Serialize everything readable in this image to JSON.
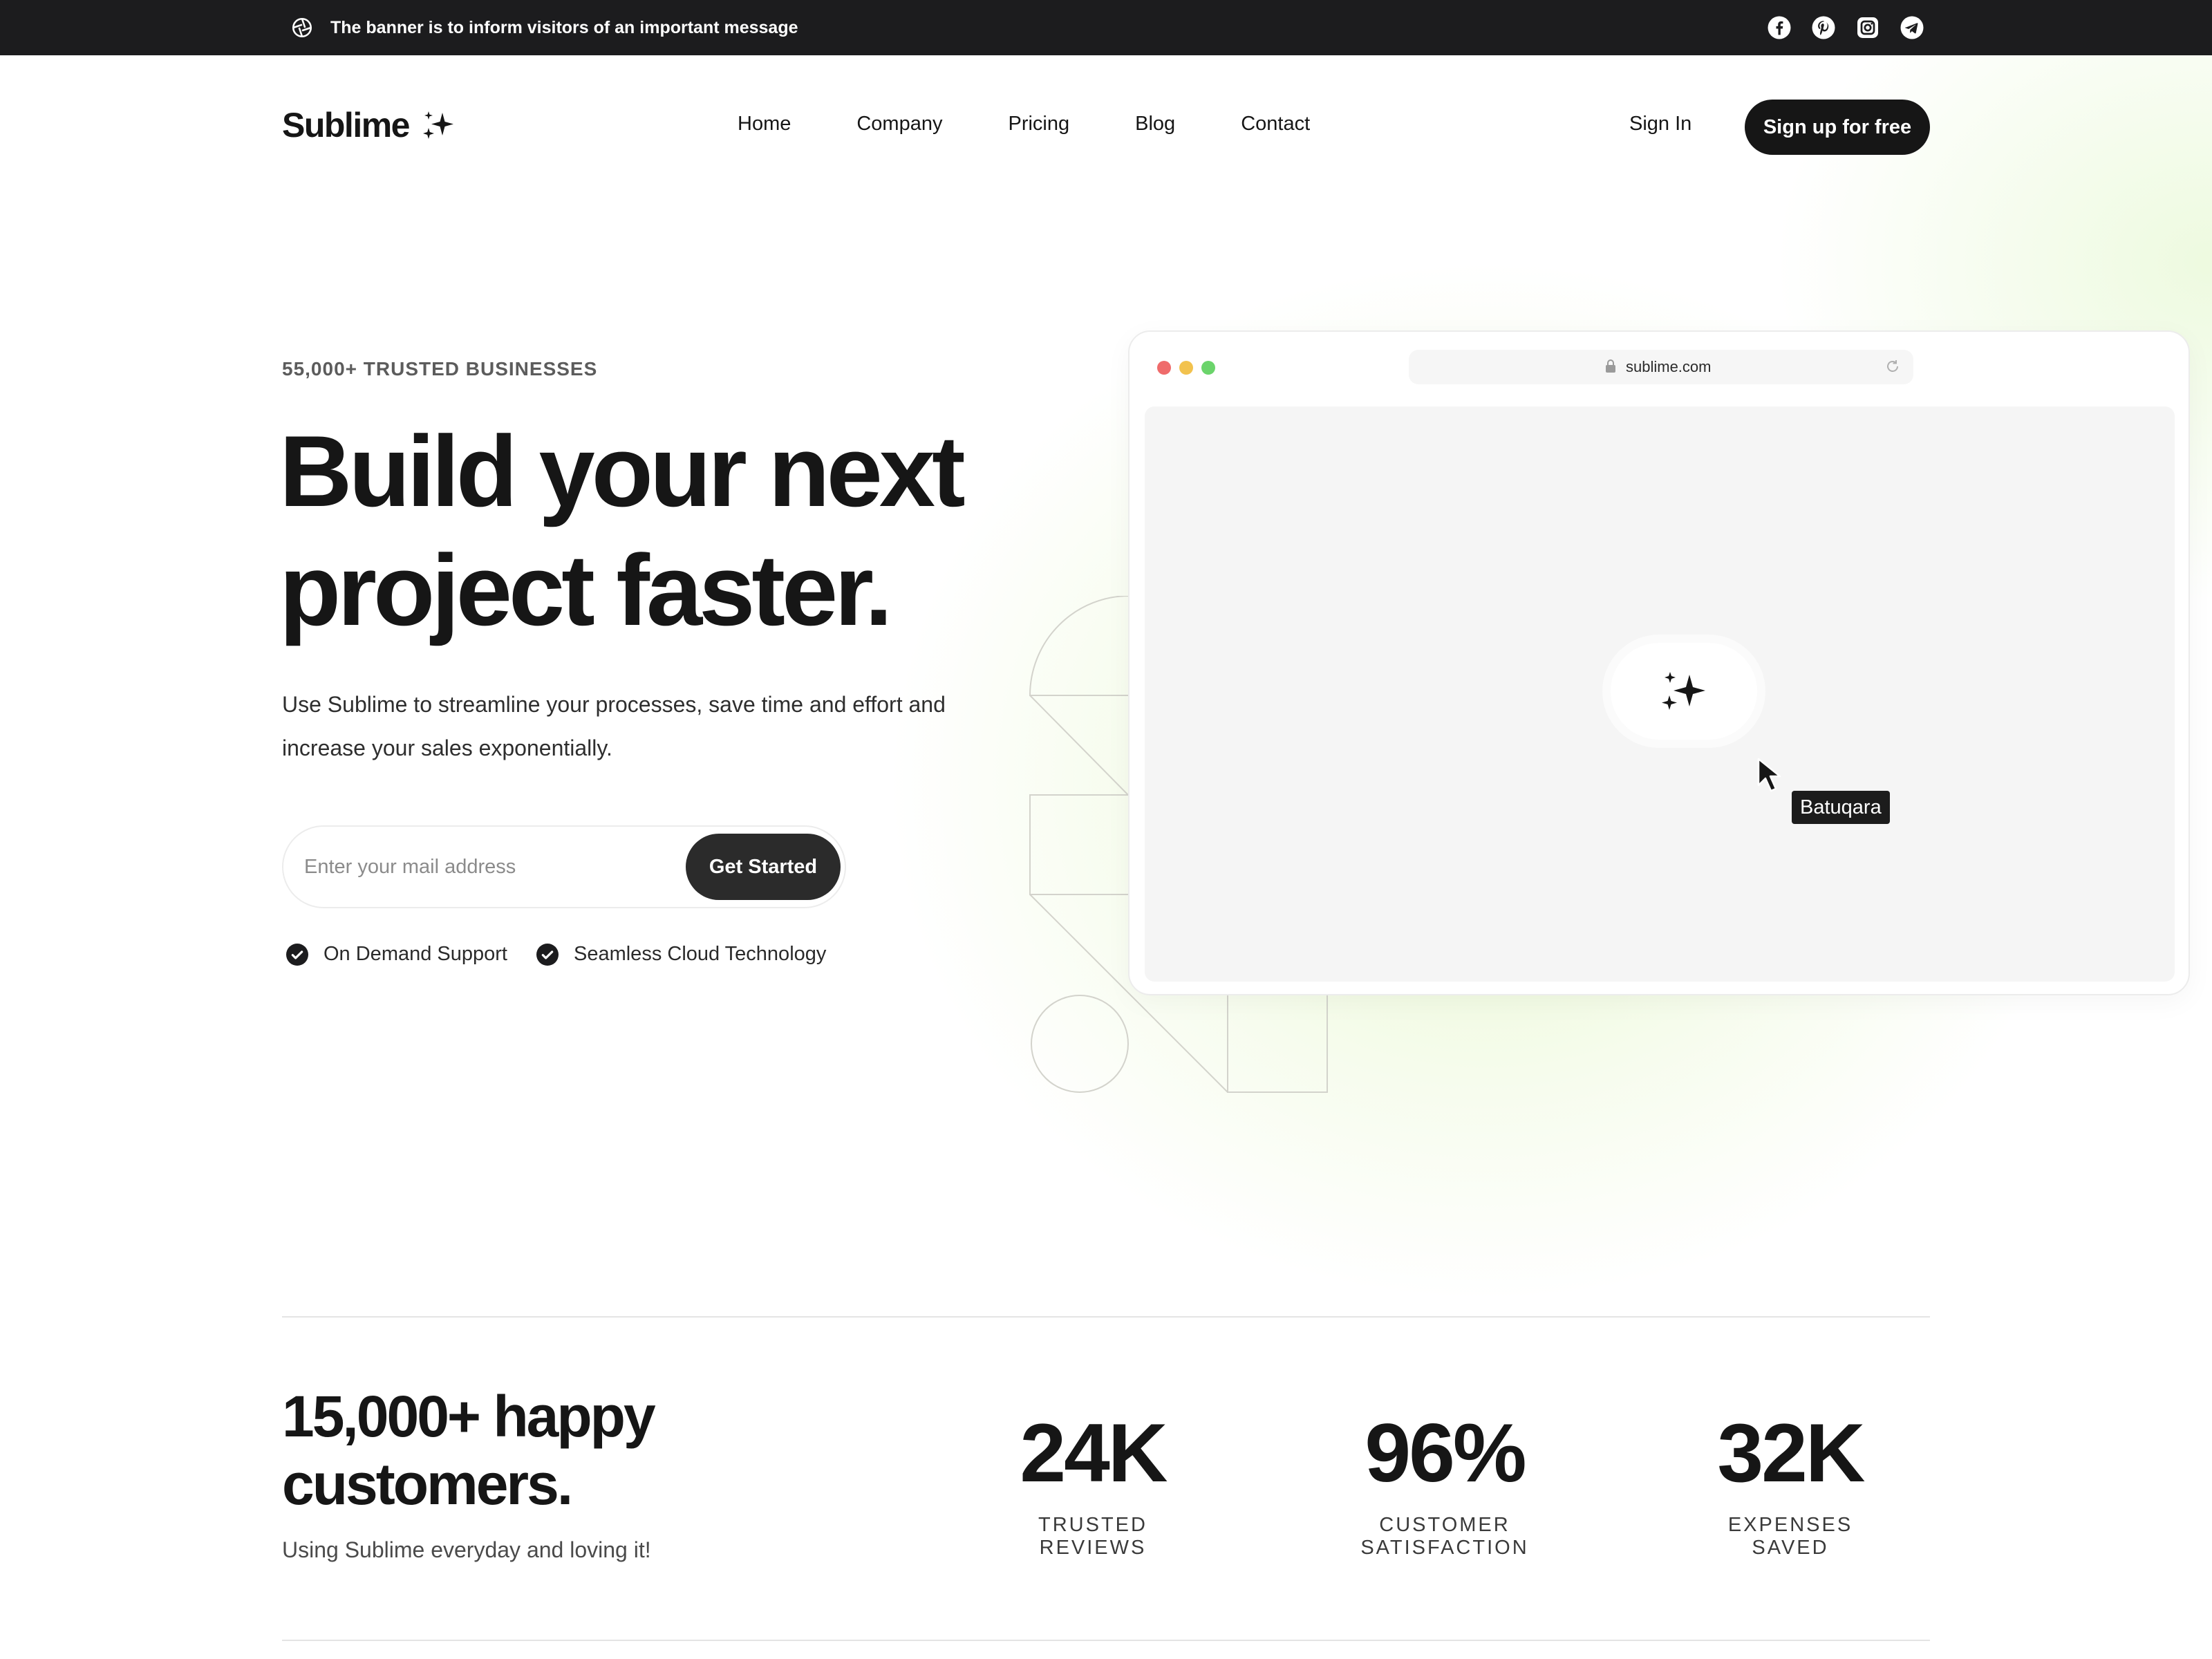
{
  "banner": {
    "message": "The banner is to inform visitors of an important message",
    "social_icons": [
      "facebook-icon",
      "pinterest-icon",
      "instagram-icon",
      "telegram-icon"
    ]
  },
  "nav": {
    "logo_text": "Sublime",
    "links": [
      "Home",
      "Company",
      "Pricing",
      "Blog",
      "Contact"
    ],
    "sign_in": "Sign In",
    "sign_up": "Sign up for free"
  },
  "hero": {
    "eyebrow": "55,000+ TRUSTED BUSINESSES",
    "headline_line1": "Build your next",
    "headline_line2": "project faster.",
    "subcopy": "Use Sublime to streamline your processes, save time and effort and increase your sales exponentially.",
    "email_placeholder": "Enter your mail address",
    "cta": "Get Started",
    "features": [
      "On Demand Support",
      "Seamless Cloud Technology"
    ]
  },
  "browser": {
    "url": "sublime.com",
    "cursor_label": "Batuqara"
  },
  "stats": {
    "headline": "15,000+ happy customers.",
    "subline": "Using Sublime everyday and loving it!",
    "items": [
      {
        "value": "24K",
        "label": "TRUSTED REVIEWS"
      },
      {
        "value": "96%",
        "label": "CUSTOMER SATISFACTION"
      },
      {
        "value": "32K",
        "label": "EXPENSES SAVED"
      }
    ]
  },
  "colors": {
    "dark": "#1c1c1e",
    "accent_glow": "#e2f6c4",
    "dot_red": "#ef6b6b",
    "dot_yellow": "#f2c24e",
    "dot_green": "#6bd46b"
  }
}
